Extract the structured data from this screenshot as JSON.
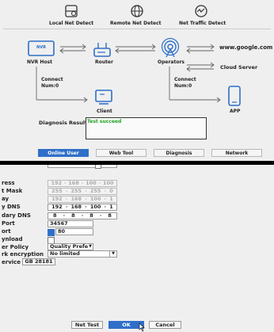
{
  "top_bar": {
    "local_net_detect": "Local Net Detect",
    "remote_net_detect": "Remote Net Detect",
    "net_traffic_detect": "Net Traffic Detect"
  },
  "diagram": {
    "nvr_host": "NVR Host",
    "nvr_box_text": "NVR",
    "router": "Router",
    "operators": "Operators",
    "google": "www.google.com",
    "cloud_server": "Cloud Server",
    "connect_left": "Connect\nNum:0",
    "connect_right": "Connect\nNum:0",
    "client": "Client",
    "app": "APP"
  },
  "diagnosis": {
    "label": "Diagnosis Result:",
    "result": "Test succeed"
  },
  "tabs": [
    "Online User",
    "Web Tool",
    "Diagnosis",
    "Network"
  ],
  "network_form": {
    "labels": [
      "ress",
      "t Mask",
      "ay",
      "y DNS",
      "dary DNS",
      "Port",
      "ort",
      "ynload",
      "er Policy",
      "rk encryption",
      "ervice"
    ],
    "ip_address": [
      "192",
      "168",
      "100",
      "100"
    ],
    "subnet_mask": [
      "255",
      "255",
      "255",
      "0"
    ],
    "gateway": [
      "192",
      "168",
      "100",
      "1"
    ],
    "primary_dns": [
      "192",
      "168",
      "100",
      "1"
    ],
    "secondary_dns": [
      "8",
      "8",
      "8",
      "8"
    ],
    "http_port": "34567",
    "rtsp_port": "80",
    "transfer_policy": "Quality Prefe",
    "network_encryption": "No limited",
    "gb28181_button": "GB 28181"
  },
  "buttons": {
    "net_test": "Net Test",
    "ok": "OK",
    "cancel": "Cancel"
  }
}
